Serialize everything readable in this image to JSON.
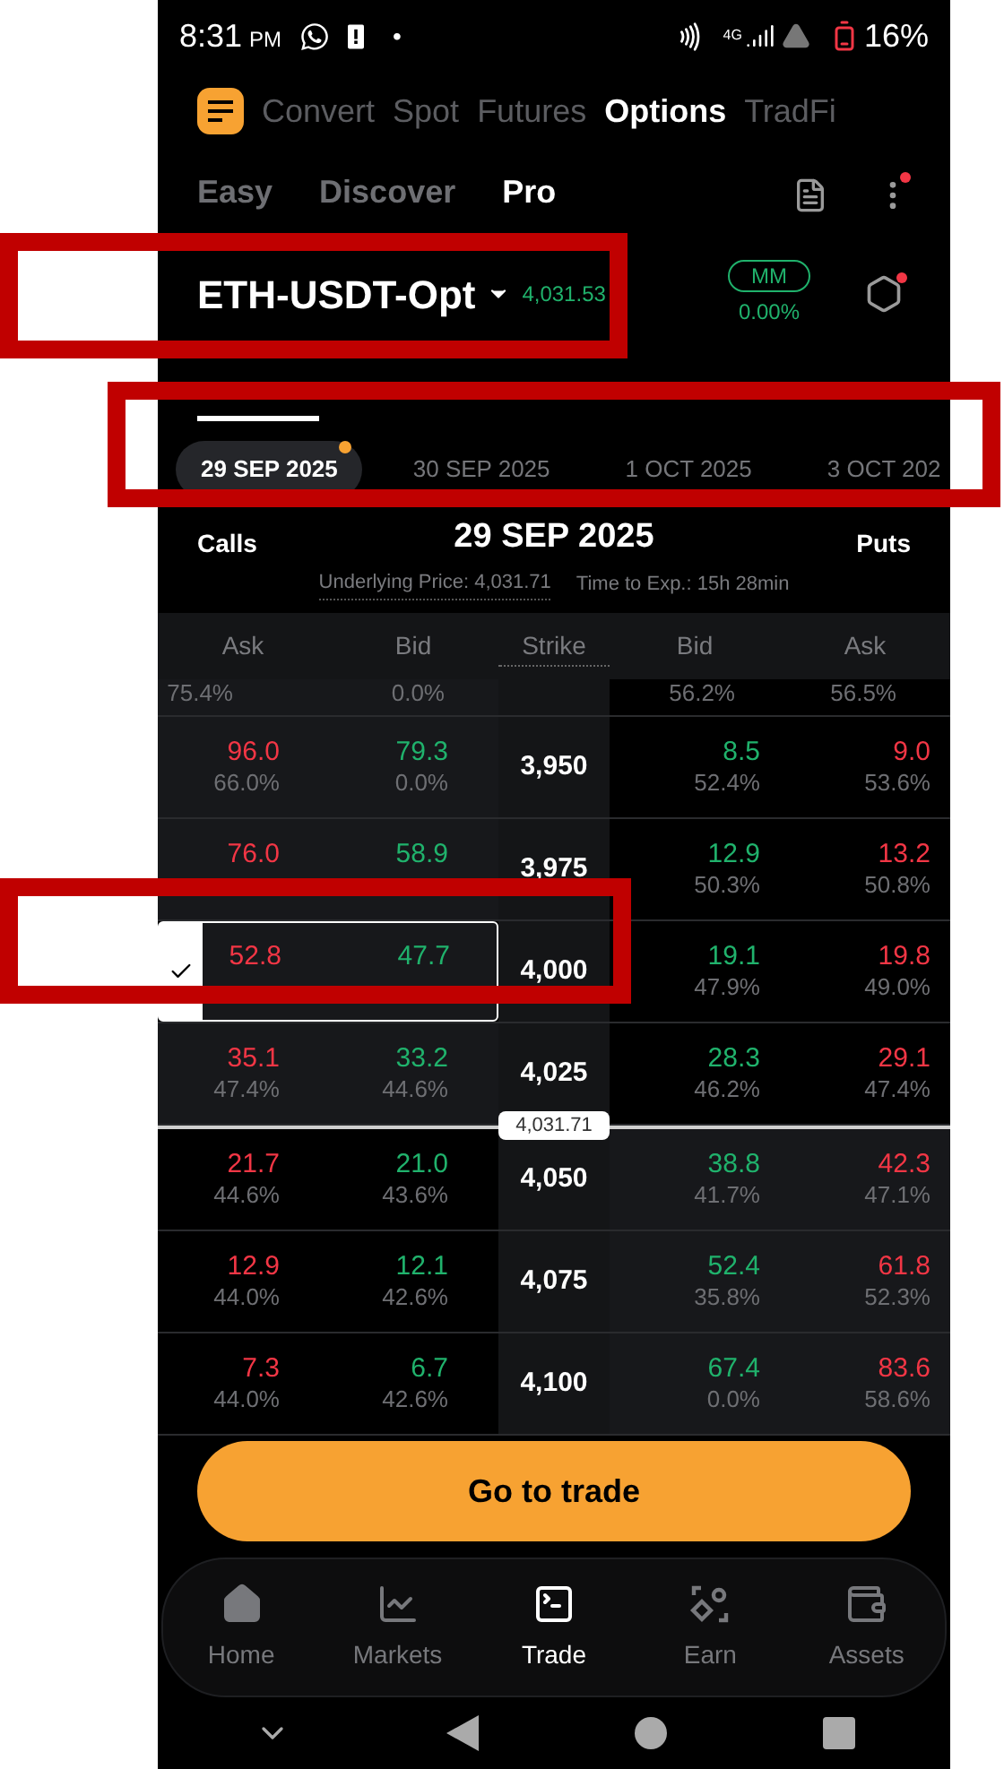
{
  "status_bar": {
    "time": "8:31",
    "ampm": "PM",
    "dot": "•",
    "network": "4G",
    "battery": "16%"
  },
  "top_nav": {
    "items": [
      {
        "label": "Convert",
        "selected": false
      },
      {
        "label": "Spot",
        "selected": false
      },
      {
        "label": "Futures",
        "selected": false
      },
      {
        "label": "Options",
        "selected": true
      },
      {
        "label": "TradFi",
        "selected": false
      }
    ]
  },
  "mode_tabs": [
    {
      "label": "Easy",
      "selected": false
    },
    {
      "label": "Discover",
      "selected": false
    },
    {
      "label": "Pro",
      "selected": true
    }
  ],
  "symbol": {
    "name": "ETH-USDT-Opt",
    "price": "4,031.53",
    "mm_badge": "MM",
    "mm_value": "0.00%"
  },
  "dates": [
    {
      "label": "29 SEP 2025",
      "selected": true
    },
    {
      "label": "30 SEP 2025",
      "selected": false
    },
    {
      "label": "1 OCT 2025",
      "selected": false
    },
    {
      "label": "3 OCT 202",
      "selected": false
    }
  ],
  "chain_header": {
    "calls": "Calls",
    "date": "29 SEP 2025",
    "puts": "Puts",
    "underlying": "Underlying Price: 4,031.71",
    "time_to_exp": "Time to Exp.: 15h 28min"
  },
  "columns": [
    "Ask",
    "Bid",
    "Strike",
    "Bid",
    "Ask"
  ],
  "rows": [
    {
      "kind": "partial",
      "calls_itm": true,
      "call_ask_iv": "75.4%",
      "call_bid_iv": "0.0%",
      "put_bid_iv": "56.2%",
      "put_ask_iv": "56.5%"
    },
    {
      "kind": "strike",
      "calls_itm": true,
      "selected": false,
      "call_ask": "96.0",
      "call_ask_iv": "66.0%",
      "call_bid": "79.3",
      "call_bid_iv": "0.0%",
      "strike": "3,950",
      "put_bid": "8.5",
      "put_bid_iv": "52.4%",
      "put_ask": "9.0",
      "put_ask_iv": "53.6%"
    },
    {
      "kind": "strike",
      "calls_itm": true,
      "selected": false,
      "call_ask": "76.0",
      "call_bid": "58.9",
      "strike": "3,975",
      "put_bid": "12.9",
      "put_bid_iv": "50.3%",
      "put_ask": "13.2",
      "put_ask_iv": "50.8%"
    },
    {
      "kind": "strike",
      "calls_itm": true,
      "selected": true,
      "call_ask": "52.8",
      "call_bid": "47.7",
      "strike": "4,000",
      "put_bid": "19.1",
      "put_bid_iv": "47.9%",
      "put_ask": "19.8",
      "put_ask_iv": "49.0%"
    },
    {
      "kind": "strike",
      "calls_itm": true,
      "selected": false,
      "call_ask": "35.1",
      "call_ask_iv": "47.4%",
      "call_bid": "33.2",
      "call_bid_iv": "44.6%",
      "strike": "4,025",
      "put_bid": "28.3",
      "put_bid_iv": "46.2%",
      "put_ask": "29.1",
      "put_ask_iv": "47.4%"
    },
    {
      "kind": "price_line",
      "label": "4,031.71"
    },
    {
      "kind": "strike",
      "calls_itm": false,
      "selected": false,
      "call_ask": "21.7",
      "call_ask_iv": "44.6%",
      "call_bid": "21.0",
      "call_bid_iv": "43.6%",
      "strike": "4,050",
      "put_bid": "38.8",
      "put_bid_iv": "41.7%",
      "put_ask": "42.3",
      "put_ask_iv": "47.1%"
    },
    {
      "kind": "strike",
      "calls_itm": false,
      "selected": false,
      "call_ask": "12.9",
      "call_ask_iv": "44.0%",
      "call_bid": "12.1",
      "call_bid_iv": "42.6%",
      "strike": "4,075",
      "put_bid": "52.4",
      "put_bid_iv": "35.8%",
      "put_ask": "61.8",
      "put_ask_iv": "52.3%"
    },
    {
      "kind": "strike",
      "calls_itm": false,
      "selected": false,
      "call_ask": "7.3",
      "call_ask_iv": "44.0%",
      "call_bid": "6.7",
      "call_bid_iv": "42.6%",
      "strike": "4,100",
      "put_bid": "67.4",
      "put_bid_iv": "0.0%",
      "put_ask": "83.6",
      "put_ask_iv": "58.6%"
    }
  ],
  "trade_button": "Go to trade",
  "bottom_nav": [
    {
      "label": "Home",
      "selected": false
    },
    {
      "label": "Markets",
      "selected": false
    },
    {
      "label": "Trade",
      "selected": true
    },
    {
      "label": "Earn",
      "selected": false
    },
    {
      "label": "Assets",
      "selected": false
    }
  ]
}
